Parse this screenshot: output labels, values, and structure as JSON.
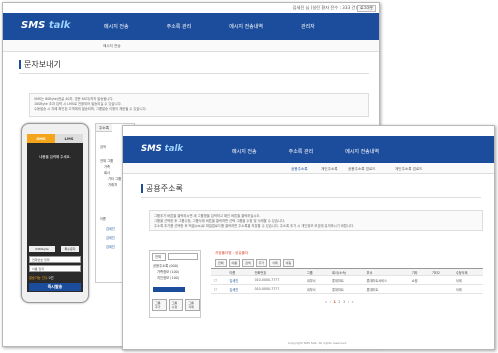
{
  "back_window": {
    "topbar": {
      "info": "김세진 님 (실린 환자 전수 : 333 건)",
      "logout": "로그아웃"
    },
    "logo": {
      "sms": "SMS",
      "talk": "talk"
    },
    "menu": [
      "메시지 전송",
      "주소록 관리",
      "메시지 전송내역",
      "관리자"
    ],
    "subnav": "메시지 전송",
    "title": "문자보내기",
    "notice": [
      "SMS는 80Byte(한글 40자, 영문 80자)까지 발송됩니다.",
      "180Byte 초과 입력 시 LMS로 전환되어 발송되실 수 있습니다.",
      "수동발송 시 차례 확인된 고객에게 발송되며, 그룹발송 이용이 제한될 수 있습니다."
    ],
    "phone": {
      "tab_sms": "SMS",
      "tab_lms": "LMS",
      "message_placeholder": "내용을 입력해 주세요.",
      "byte_count": "0/80byte",
      "special_chars": "특수문자",
      "phone_field": "전화번호 입력",
      "name_field": "이름 입력",
      "receivers": "수신자 목록",
      "remain_left": "발송가능 건수",
      "remain_right": "0건",
      "send": "즉시발송"
    },
    "panel": {
      "tab": "주소록",
      "search_label": "검색",
      "tree": [
        "전체 그룹",
        "가족",
        "회사",
        "기타 그룹",
        "거래처"
      ],
      "col_name": "이름",
      "rows": [
        "김세진",
        "김세진",
        "김세진"
      ]
    }
  },
  "front_window": {
    "logo": {
      "sms": "SMS",
      "talk": "talk"
    },
    "menu": [
      "메시지 전송",
      "주소록 관리",
      "메시지 전송내역"
    ],
    "subnav": [
      "공용주소록",
      "개인주소록",
      "공용주소록 업로드",
      "개인주소록 업로드"
    ],
    "title": "공용주소록",
    "notice": [
      "그룹추가 버튼을 클릭하시면 새 그룹명을 입력하고 확인 버튼을 클릭하십시오.",
      "그룹을 선택한 후 그룹수정, 그룹삭제 버튼을 클릭하면 선택 그룹을 수정 및 삭제할 수 있습니다.",
      "주소록 추가를 선택한 후 엑셀(xls)로 파일업로드를 클릭하면 주소록을 저장할 수 있습니다. 주소록 추가 시 개인정보 보호에 유의하시기 바랍니다."
    ],
    "left_panel": {
      "select": "전체",
      "search": "검색",
      "tree": [
        "공용주소록 (000)",
        "가족정보 (100)",
        "지인정보 (100)"
      ],
      "buttons": [
        "그룹 추가",
        "그룹 수정",
        "그룹 삭제"
      ]
    },
    "right_panel": {
      "breadcrumb": "지정폴더명 : 공유폴더",
      "tools": [
        "전체",
        "이름",
        "검색",
        "추가",
        "삭제",
        "이동"
      ],
      "columns": [
        "",
        "이름",
        "전화번호",
        "그룹",
        "회사(소속)",
        "부서",
        "기타",
        "기타2",
        "수정삭제"
      ],
      "rows": [
        [
          "",
          "김세진",
          "010-0000-7777",
          "내부서",
          "롯데마트",
          "롯데마트서비스",
          "쇼핑",
          "",
          "삭제"
        ],
        [
          "",
          "김세진",
          "010-0000-7777",
          "내부서",
          "롯데마트",
          "롯데마트",
          "",
          "",
          "삭제"
        ]
      ],
      "pager": [
        "«",
        "‹",
        "1",
        "2",
        "3",
        "›",
        "»"
      ]
    },
    "footer": "Copyright SMS talk. All rights reserved."
  }
}
